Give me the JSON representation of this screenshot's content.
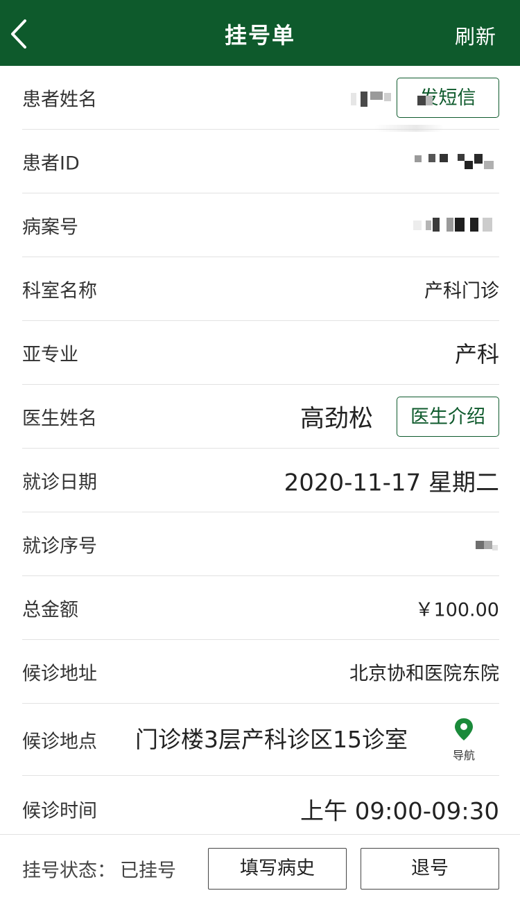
{
  "navbar": {
    "title": "挂号单",
    "refresh_label": "刷新",
    "bg_color": "#0e5a2c"
  },
  "rows": {
    "patient_name": {
      "label": "患者姓名",
      "button": "发短信"
    },
    "patient_id": {
      "label": "患者ID"
    },
    "case_no": {
      "label": "病案号"
    },
    "department": {
      "label": "科室名称",
      "value": "产科门诊"
    },
    "subspecialty": {
      "label": "亚专业",
      "value": "产科"
    },
    "doctor": {
      "label": "医生姓名",
      "value": "高劲松",
      "button": "医生介绍"
    },
    "visit_date": {
      "label": "就诊日期",
      "value": "2020-11-17 星期二"
    },
    "visit_seq": {
      "label": "就诊序号"
    },
    "total": {
      "label": "总金额",
      "value": "￥100.00"
    },
    "wait_address": {
      "label": "候诊地址",
      "value": "北京协和医院东院"
    },
    "wait_place": {
      "label": "候诊地点",
      "value": "门诊楼3层产科诊区15诊室",
      "nav_label": "导航"
    },
    "wait_time": {
      "label": "候诊时间",
      "value": "上午 09:00-09:30"
    }
  },
  "bottom": {
    "status_label": "挂号状态：",
    "status_value": "已挂号",
    "fill_history": "填写病史",
    "cancel": "退号"
  },
  "icons": {
    "back": "chevron-left-icon",
    "nav": "map-pin-icon"
  },
  "colors": {
    "accent_green": "#0e5a2c",
    "pin_green": "#1a8a3a"
  }
}
